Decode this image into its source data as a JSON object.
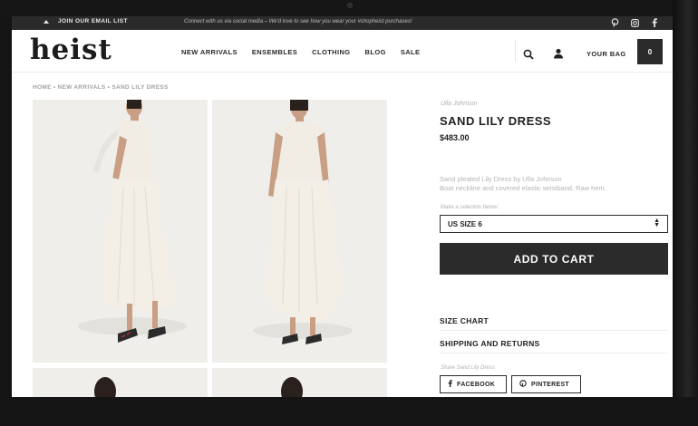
{
  "topbar": {
    "email_cta": "JOIN OUR EMAIL LIST",
    "social_message": "Connect with us via social media – We'd love to see how you wear your #shopheist purchases!",
    "social_icons": [
      "pinterest-icon",
      "instagram-icon",
      "facebook-icon"
    ]
  },
  "header": {
    "logo": "heist",
    "nav": [
      "NEW ARRIVALS",
      "ENSEMBLES",
      "CLOTHING",
      "BLOG",
      "SALE"
    ],
    "bag_label": "YOUR BAG",
    "bag_count": "0"
  },
  "breadcrumb": "HOME • NEW ARRIVALS • SAND LILY DRESS",
  "product": {
    "brand": "Ulla Johnson",
    "title": "SAND LILY DRESS",
    "price": "$483.00",
    "description_line1": "Sand pleated Lily Dress by Ulla Johnson",
    "description_line2": "Boat neckline and covered elastic wristband. Raw hem.",
    "selection_label": "Make a selection below:",
    "selected_size": "US SIZE 6",
    "add_to_cart": "ADD TO CART",
    "accordion": [
      "SIZE CHART",
      "SHIPPING AND RETURNS"
    ],
    "share_label": "Share Sand Lily Dress",
    "share_facebook": "FACEBOOK",
    "share_pinterest": "PINTEREST"
  },
  "colors": {
    "dark": "#2b2b2b",
    "dress": "#f1ece3",
    "photo_bg": "#efeeeb"
  }
}
